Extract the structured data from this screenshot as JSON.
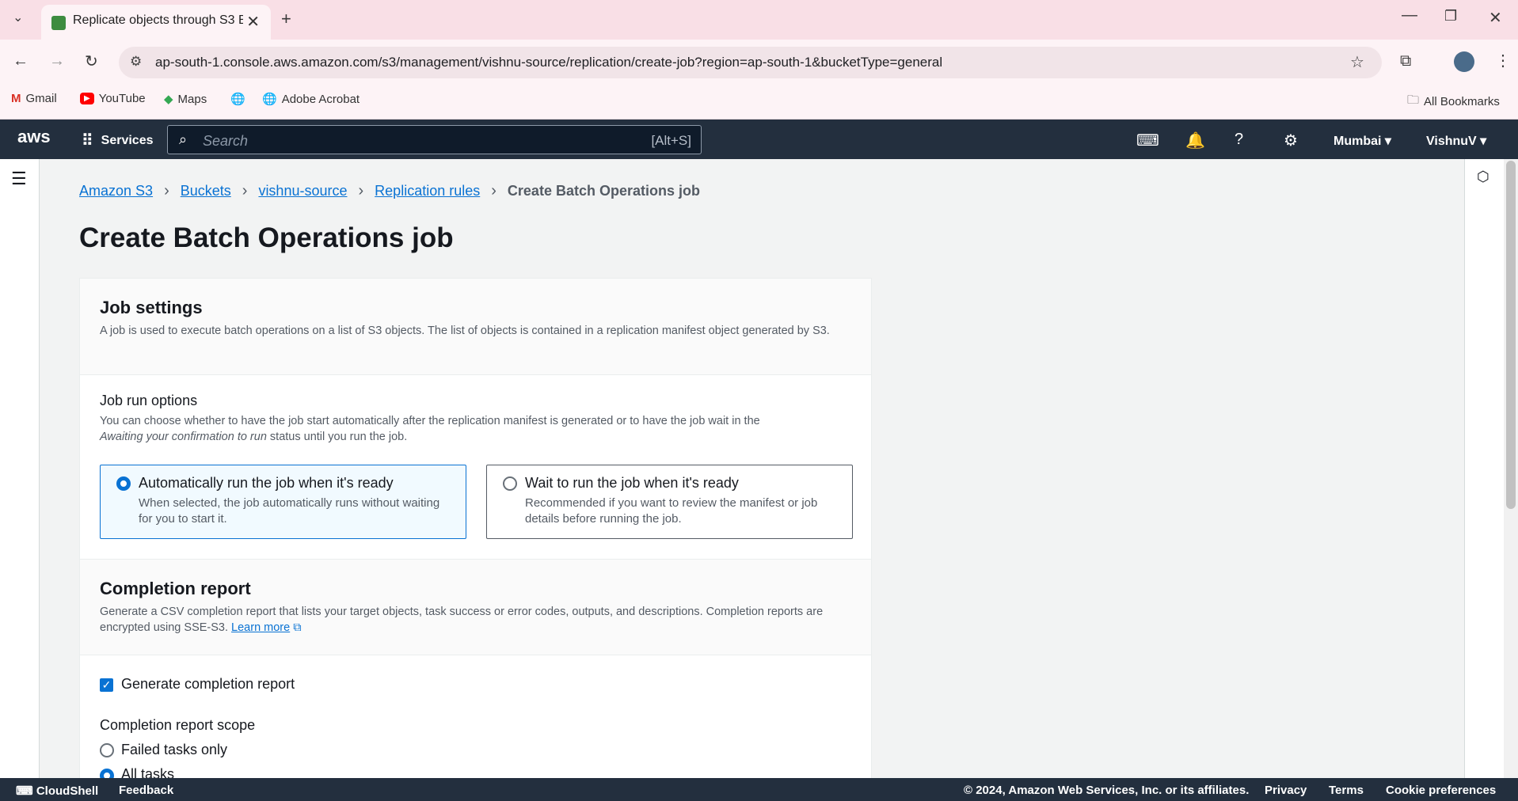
{
  "browser": {
    "tab_title": "Replicate objects through S3 Ba",
    "url": "ap-south-1.console.aws.amazon.com/s3/management/vishnu-source/replication/create-job?region=ap-south-1&bucketType=general",
    "bookmarks": [
      "Gmail",
      "YouTube",
      "Maps",
      "Adobe Acrobat"
    ],
    "all_bookmarks": "All Bookmarks"
  },
  "aws_nav": {
    "logo": "aws",
    "services": "Services",
    "search_placeholder": "Search",
    "search_shortcut": "[Alt+S]",
    "region": "Mumbai",
    "account": "VishnuV"
  },
  "breadcrumb": {
    "items": [
      "Amazon S3",
      "Buckets",
      "vishnu-source",
      "Replication rules"
    ],
    "current": "Create Batch Operations job"
  },
  "page_title": "Create Batch Operations job",
  "job_settings": {
    "title": "Job settings",
    "description": "A job is used to execute batch operations on a list of S3 objects. The list of objects is contained in a replication manifest object generated by S3.",
    "run_options_label": "Job run options",
    "run_options_desc_1": "You can choose whether to have the job start automatically after the replication manifest is generated or to have the job wait in the",
    "run_options_desc_italic": "Awaiting your confirmation to run",
    "run_options_desc_2": " status until you run the job.",
    "options": [
      {
        "title": "Automatically run the job when it's ready",
        "description": "When selected, the job automatically runs without waiting for you to start it."
      },
      {
        "title": "Wait to run the job when it's ready",
        "description": "Recommended if you want to review the manifest or job details before running the job."
      }
    ]
  },
  "completion_report": {
    "title": "Completion report",
    "description": "Generate a CSV completion report that lists your target objects, task success or error codes, outputs, and descriptions. Completion reports are encrypted using SSE-S3.",
    "learn_more": "Learn more",
    "generate_label": "Generate completion report",
    "scope_label": "Completion report scope",
    "scope_options": [
      "Failed tasks only",
      "All tasks"
    ]
  },
  "footer": {
    "cloudshell": "CloudShell",
    "feedback": "Feedback",
    "copyright": "© 2024, Amazon Web Services, Inc. or its affiliates.",
    "privacy": "Privacy",
    "terms": "Terms",
    "cookies": "Cookie preferences"
  }
}
